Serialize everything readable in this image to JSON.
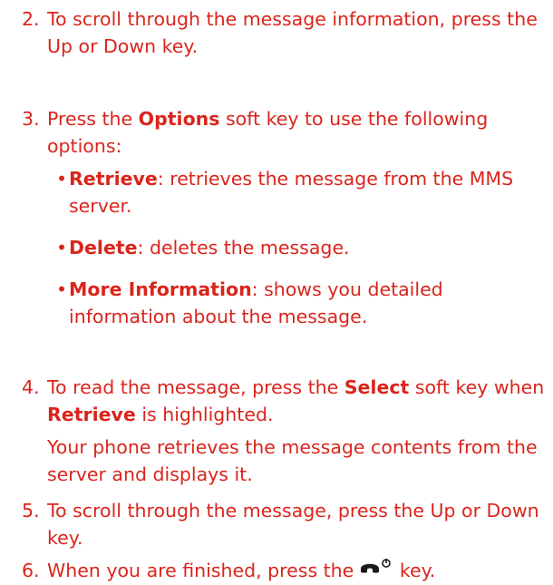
{
  "steps": {
    "s2": {
      "number": "2.",
      "text": "To scroll through the message information, press the Up or Down key."
    },
    "s3": {
      "number": "3.",
      "before": "Press the ",
      "bold": "Options",
      "after": " soft key to use the following options:",
      "bullets": [
        {
          "term": "Retrieve",
          "desc": ": retrieves the message from the MMS server."
        },
        {
          "term": "Delete",
          "desc": ": deletes the message."
        },
        {
          "term": "More Information",
          "desc": ": shows you detailed information about the message."
        }
      ]
    },
    "s4": {
      "number": "4.",
      "before": "To read the message, press the ",
      "bold1": "Select",
      "middle": " soft key when ",
      "bold2": "Retrieve",
      "after": " is highlighted.",
      "note": "Your phone retrieves the message contents from the server and displays it."
    },
    "s5": {
      "number": "5.",
      "text": "To scroll through the message, press the Up or Down key."
    },
    "s6": {
      "number": "6.",
      "before": "When you are finished, press the",
      "after": " key.",
      "key_icon": "end-key-icon"
    }
  },
  "colors": {
    "text": "#d9251c",
    "icon": "#1a1a1a"
  },
  "bullet_glyph": "•"
}
